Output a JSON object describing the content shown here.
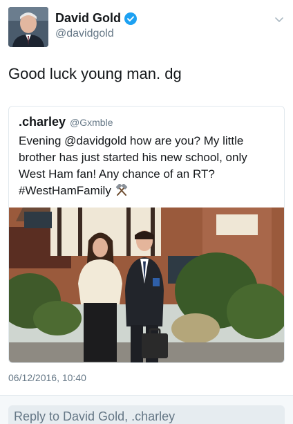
{
  "tweet": {
    "author_name": "David Gold",
    "author_handle": "@davidgold",
    "verified": true,
    "text": "Good luck young man. dg",
    "timestamp": "06/12/2016, 10:40"
  },
  "quoted_tweet": {
    "author_name": ".charley",
    "author_handle": "@Gxmble",
    "lines": [
      "Evening @davidgold how are you? My little",
      "brother has just started his new school, only",
      "West Ham fan! Any chance of an RT?",
      "#WestHamFamily"
    ],
    "emoji_icon": "hammers-icon"
  },
  "reply": {
    "placeholder": "Reply to David Gold, .charley"
  },
  "colors": {
    "text": "#14171a",
    "secondary": "#657786",
    "border": "#e1e8ed",
    "verified_blue": "#1da1f2",
    "reply_bg": "#e6ecf0"
  }
}
